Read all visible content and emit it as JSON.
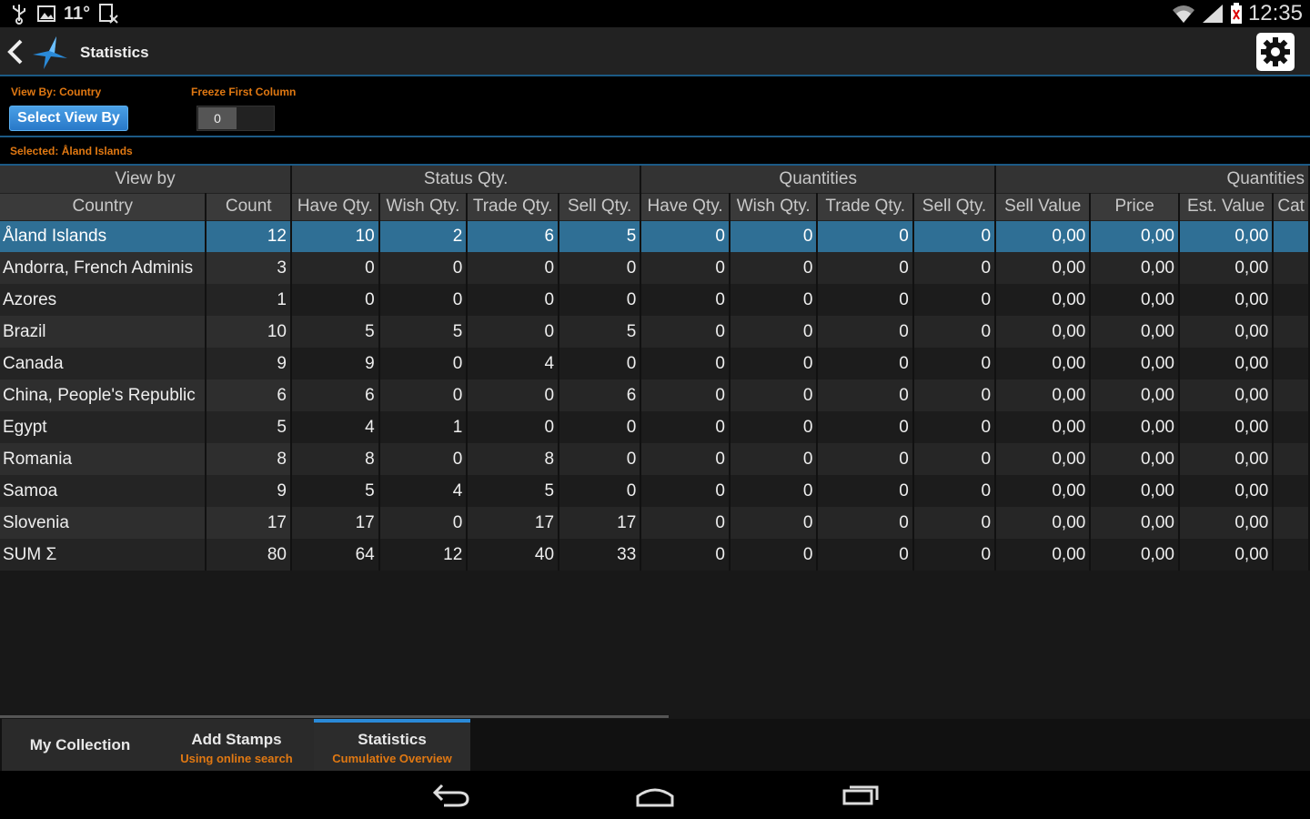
{
  "status_bar": {
    "temperature": "11°",
    "time": "12:35"
  },
  "header": {
    "title": "Statistics"
  },
  "controls": {
    "view_by_label": "View By: Country",
    "freeze_label": "Freeze First Column",
    "select_button": "Select View By",
    "freeze_value": "0",
    "selected_label": "Selected: Åland Islands"
  },
  "table": {
    "groups": [
      "View by",
      "Status Qty.",
      "Quantities",
      "Quantities"
    ],
    "columns": [
      "Country",
      "Count",
      "Have Qty.",
      "Wish Qty.",
      "Trade Qty.",
      "Sell Qty.",
      "Have Qty.",
      "Wish Qty.",
      "Trade Qty.",
      "Sell Qty.",
      "Sell Value",
      "Price",
      "Est. Value",
      "Cat"
    ],
    "rows": [
      [
        "Åland Islands",
        "12",
        "10",
        "2",
        "6",
        "5",
        "0",
        "0",
        "0",
        "0",
        "0,00",
        "0,00",
        "0,00",
        ""
      ],
      [
        "Andorra, French Adminis",
        "3",
        "0",
        "0",
        "0",
        "0",
        "0",
        "0",
        "0",
        "0",
        "0,00",
        "0,00",
        "0,00",
        ""
      ],
      [
        "Azores",
        "1",
        "0",
        "0",
        "0",
        "0",
        "0",
        "0",
        "0",
        "0",
        "0,00",
        "0,00",
        "0,00",
        ""
      ],
      [
        "Brazil",
        "10",
        "5",
        "5",
        "0",
        "5",
        "0",
        "0",
        "0",
        "0",
        "0,00",
        "0,00",
        "0,00",
        ""
      ],
      [
        "Canada",
        "9",
        "9",
        "0",
        "4",
        "0",
        "0",
        "0",
        "0",
        "0",
        "0,00",
        "0,00",
        "0,00",
        ""
      ],
      [
        "China, People's Republic",
        "6",
        "6",
        "0",
        "0",
        "6",
        "0",
        "0",
        "0",
        "0",
        "0,00",
        "0,00",
        "0,00",
        ""
      ],
      [
        "Egypt",
        "5",
        "4",
        "1",
        "0",
        "0",
        "0",
        "0",
        "0",
        "0",
        "0,00",
        "0,00",
        "0,00",
        ""
      ],
      [
        "Romania",
        "8",
        "8",
        "0",
        "8",
        "0",
        "0",
        "0",
        "0",
        "0",
        "0,00",
        "0,00",
        "0,00",
        ""
      ],
      [
        "Samoa",
        "9",
        "5",
        "4",
        "5",
        "0",
        "0",
        "0",
        "0",
        "0",
        "0,00",
        "0,00",
        "0,00",
        ""
      ],
      [
        "Slovenia",
        "17",
        "17",
        "0",
        "17",
        "17",
        "0",
        "0",
        "0",
        "0",
        "0,00",
        "0,00",
        "0,00",
        ""
      ],
      [
        "SUM Σ",
        "80",
        "64",
        "12",
        "40",
        "33",
        "0",
        "0",
        "0",
        "0",
        "0,00",
        "0,00",
        "0,00",
        ""
      ]
    ]
  },
  "tabs": [
    {
      "title": "My Collection",
      "subtitle": ""
    },
    {
      "title": "Add Stamps",
      "subtitle": "Using online search"
    },
    {
      "title": "Statistics",
      "subtitle": "Cumulative Overview"
    }
  ],
  "colors": {
    "accent": "#2a8ad8",
    "selection": "#2f6f95",
    "label_orange": "#e07812"
  }
}
